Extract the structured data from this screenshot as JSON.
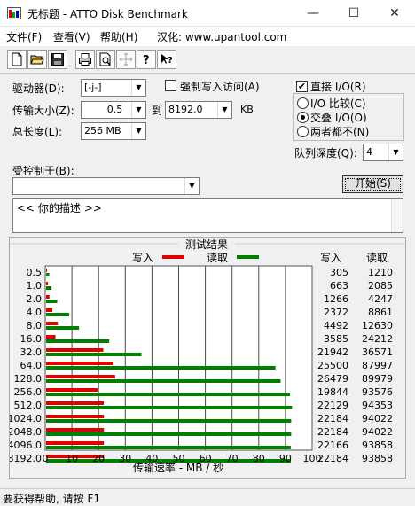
{
  "window": {
    "title": "无标题 - ATTO Disk Benchmark",
    "minimize": "—",
    "maximize": "☐",
    "close": "✕"
  },
  "menu": {
    "items": [
      "文件(F)",
      "查看(V)",
      "帮助(H)",
      "汉化: www.upantool.com"
    ]
  },
  "toolbar": {
    "icons": [
      "new-file-icon",
      "open-folder-icon",
      "save-icon",
      "print-icon",
      "print-preview-icon",
      "move-icon",
      "help-icon",
      "context-help-icon"
    ]
  },
  "form": {
    "drive_label": "驱动器(D):",
    "drive_value": "[-j-]",
    "force_write_label": "强制写入访问(A)",
    "transfer_label": "传输大小(Z):",
    "transfer_from": "0.5",
    "to_label": "到",
    "transfer_to": "8192.0",
    "kb_label": "KB",
    "total_label": "总长度(L):",
    "total_value": "256 MB",
    "direct_io_label": "直接 I/O(R)",
    "direct_io_checked": "✔",
    "io_compare_label": "I/O 比较(C)",
    "overlap_io_label": "交叠 I/O(O)",
    "neither_label": "两者都不(N)",
    "queue_label": "队列深度(Q):",
    "queue_value": "4",
    "controlled_label": "受控制于(B):",
    "controlled_value": "",
    "start_button": "开始(S)",
    "description": "<<  你的描述  >>"
  },
  "chart_data": {
    "type": "bar",
    "title": "测试结果",
    "legend_write": "写入",
    "legend_read": "读取",
    "col_write": "写入",
    "col_read": "读取",
    "xlabel": "传输速率 - MB / 秒",
    "xlim": [
      0,
      100
    ],
    "xticks": [
      "0",
      "10",
      "20",
      "30",
      "40",
      "50",
      "60",
      "70",
      "80",
      "90",
      "100"
    ],
    "categories": [
      "0.5",
      "1.0",
      "2.0",
      "4.0",
      "8.0",
      "16.0",
      "32.0",
      "64.0",
      "128.0",
      "256.0",
      "512.0",
      "1024.0",
      "2048.0",
      "4096.0",
      "8192.0"
    ],
    "series": [
      {
        "name": "写入",
        "color": "#e00000",
        "values": [
          305,
          663,
          1266,
          2372,
          4492,
          3585,
          21942,
          25500,
          26479,
          19844,
          22129,
          22184,
          22184,
          22166,
          22184
        ]
      },
      {
        "name": "读取",
        "color": "#008000",
        "values": [
          1210,
          2085,
          4247,
          8861,
          12630,
          24212,
          36571,
          87997,
          89979,
          93576,
          94353,
          94022,
          94022,
          93858,
          93858
        ]
      }
    ]
  },
  "status": {
    "text": "要获得帮助, 请按 F1"
  }
}
